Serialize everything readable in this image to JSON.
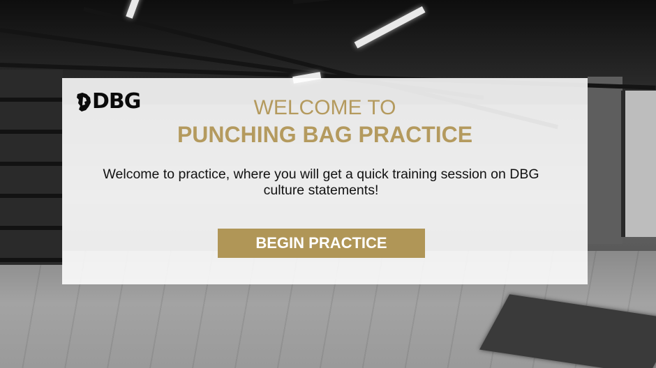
{
  "logo": {
    "text": "DBG"
  },
  "welcome": {
    "line1": "WELCOME TO",
    "line2": "PUNCHING BAG PRACTICE",
    "description": "Welcome to practice, where you will get a quick training session on DBG culture statements!"
  },
  "actions": {
    "begin_label": "BEGIN PRACTICE"
  },
  "colors": {
    "accent": "#b09657",
    "accent_text": "#b49a5e",
    "panel": "#ffffff"
  }
}
